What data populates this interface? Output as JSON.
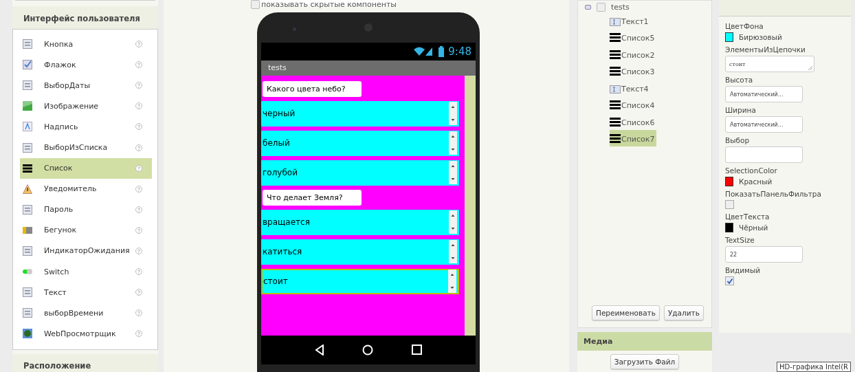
{
  "palette": {
    "header": "Интерфейс пользователя",
    "items": [
      {
        "kind": "button",
        "label": "Кнопка",
        "selected": false
      },
      {
        "kind": "checkbox",
        "label": "Флажок",
        "selected": false
      },
      {
        "kind": "datepicker",
        "label": "ВыборДаты",
        "selected": false
      },
      {
        "kind": "image",
        "label": "Изображение",
        "selected": false
      },
      {
        "kind": "label",
        "label": "Надпись",
        "selected": false
      },
      {
        "kind": "listpicker",
        "label": "ВыборИзСписка",
        "selected": false
      },
      {
        "kind": "listview",
        "label": "Список",
        "selected": true
      },
      {
        "kind": "notifier",
        "label": "Уведомитель",
        "selected": false
      },
      {
        "kind": "password",
        "label": "Пароль",
        "selected": false
      },
      {
        "kind": "slider",
        "label": "Бегунок",
        "selected": false
      },
      {
        "kind": "progress",
        "label": "ИндикаторОжидания",
        "selected": false
      },
      {
        "kind": "switch",
        "label": "Switch",
        "selected": false
      },
      {
        "kind": "textbox",
        "label": "Текст",
        "selected": false
      },
      {
        "kind": "timepicker",
        "label": "выборВремени",
        "selected": false
      },
      {
        "kind": "webviewer",
        "label": "WebПросмотрщик",
        "selected": false
      }
    ],
    "next_header": "Расположение"
  },
  "viewer": {
    "show_hidden": {
      "label": "показывать скрытые компоненты",
      "checked": false
    },
    "phone": {
      "time": "9:48",
      "title": "tests",
      "items": [
        {
          "kind": "label",
          "text": "Какого цвета небо?"
        },
        {
          "kind": "list",
          "text": "черный",
          "selected": false
        },
        {
          "kind": "list",
          "text": "белый",
          "selected": false
        },
        {
          "kind": "list",
          "text": "голубой",
          "selected": false
        },
        {
          "kind": "label",
          "text": "Что делает Земля?"
        },
        {
          "kind": "list",
          "text": "вращается",
          "selected": false
        },
        {
          "kind": "list",
          "text": "катиться",
          "selected": false
        },
        {
          "kind": "list",
          "text": "стоит",
          "selected": true
        }
      ]
    }
  },
  "components": {
    "root": {
      "label": "tests",
      "expanded": true,
      "checked": false
    },
    "children": [
      {
        "kind": "text",
        "label": "Текст1",
        "selected": false
      },
      {
        "kind": "list",
        "label": "Список5",
        "selected": false
      },
      {
        "kind": "list",
        "label": "Список2",
        "selected": false
      },
      {
        "kind": "list",
        "label": "Список3",
        "selected": false
      },
      {
        "kind": "text",
        "label": "Текст4",
        "selected": false
      },
      {
        "kind": "list",
        "label": "Список4",
        "selected": false
      },
      {
        "kind": "list",
        "label": "Список6",
        "selected": false
      },
      {
        "kind": "list",
        "label": "Список7",
        "selected": true
      }
    ],
    "buttons": [
      "Переименовать",
      "Удалить"
    ]
  },
  "media": {
    "header": "Медиа",
    "upload": "Загрузить Файл"
  },
  "properties": [
    {
      "kind": "color",
      "label": "ЦветФона",
      "value": "Бирюзовый",
      "color": "#00ffff"
    },
    {
      "kind": "textarea",
      "label": "ЭлементыИзЦепочки",
      "value": "стоит"
    },
    {
      "kind": "input",
      "label": "Высота",
      "value": "Автоматический..."
    },
    {
      "kind": "input",
      "label": "Ширина",
      "value": "Автоматический..."
    },
    {
      "kind": "input",
      "label": "Выбор"
    },
    {
      "kind": "color",
      "label": "SelectionColor",
      "value": "Красный",
      "color": "#ff0000"
    },
    {
      "kind": "checkbox",
      "label": "ПоказатьПанельФильтра",
      "checked": false
    },
    {
      "kind": "color",
      "label": "ЦветТекста",
      "value": "Чёрный",
      "color": "#000000"
    },
    {
      "kind": "input",
      "label": "TextSize",
      "value": "22"
    },
    {
      "kind": "checkbox",
      "label": "Видимый",
      "checked": true
    }
  ],
  "tooltip": "HD-графика Intel(R"
}
